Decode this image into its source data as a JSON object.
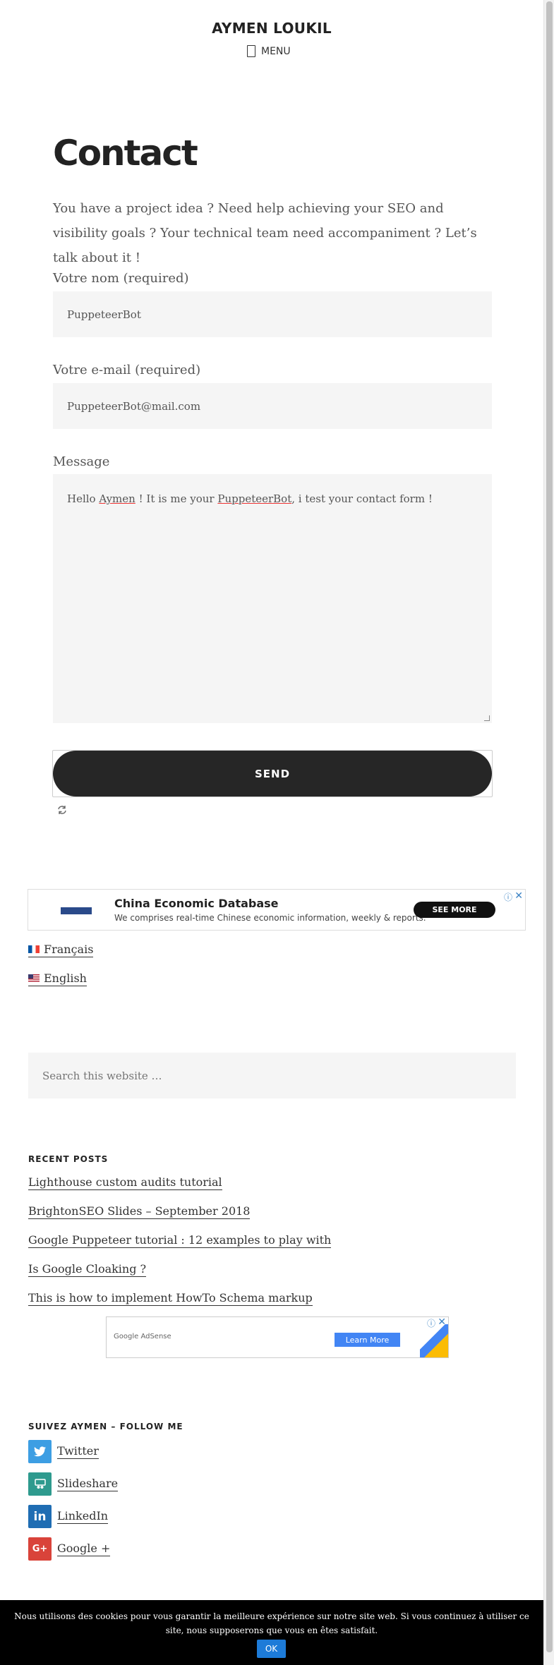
{
  "header": {
    "site_title": "AYMEN LOUKIL",
    "menu_label": "MENU"
  },
  "page": {
    "title": "Contact",
    "intro": "You have a project idea ? Need help achieving your SEO and visibility goals ? Your technical team need accompaniment ? Let’s talk about it !"
  },
  "form": {
    "name_label": "Votre nom (required)",
    "name_value": "PuppeteerBot",
    "email_label": "Votre e-mail (required)",
    "email_value": "PuppeteerBot@mail.com",
    "message_label": "Message",
    "message_parts": [
      "Hello ",
      "Aymen",
      " ! It is me your ",
      "PuppeteerBot",
      ", i test your contact form !"
    ],
    "send_label": "SEND"
  },
  "ad": {
    "title": "China Economic Database",
    "text": "We comprises real-time Chinese economic information, weekly & reports.",
    "cta": "SEE MORE"
  },
  "languages": [
    {
      "label": "Français"
    },
    {
      "label": "English"
    }
  ],
  "search": {
    "placeholder": "Search this website …"
  },
  "recent_posts": {
    "title": "RECENT POSTS",
    "items": [
      "Lighthouse custom audits tutorial",
      "BrightonSEO Slides – September 2018",
      "Google Puppeteer tutorial : 12 examples to play with",
      "Is Google Cloaking ?",
      "This is how to implement HowTo Schema markup"
    ]
  },
  "adsense": {
    "brand": "Google AdSense",
    "cta": "Learn More"
  },
  "follow": {
    "title": "SUIVEZ AYMEN – FOLLOW ME",
    "items": [
      {
        "label": "Twitter",
        "icon": "twitter-icon",
        "color": "#3d9ee3"
      },
      {
        "label": "Slideshare",
        "icon": "slideshare-icon",
        "color": "#2e9a8e"
      },
      {
        "label": "LinkedIn",
        "icon": "linkedin-icon",
        "color": "#1f6db3"
      },
      {
        "label": "Google +",
        "icon": "google-plus-icon",
        "color": "#d9433a"
      }
    ]
  },
  "cookie": {
    "text": "Nous utilisons des cookies pour vous garantir la meilleure expérience sur notre site web. Si vous continuez à utiliser ce site, nous supposerons que vous en êtes satisfait.",
    "ok": "OK"
  }
}
